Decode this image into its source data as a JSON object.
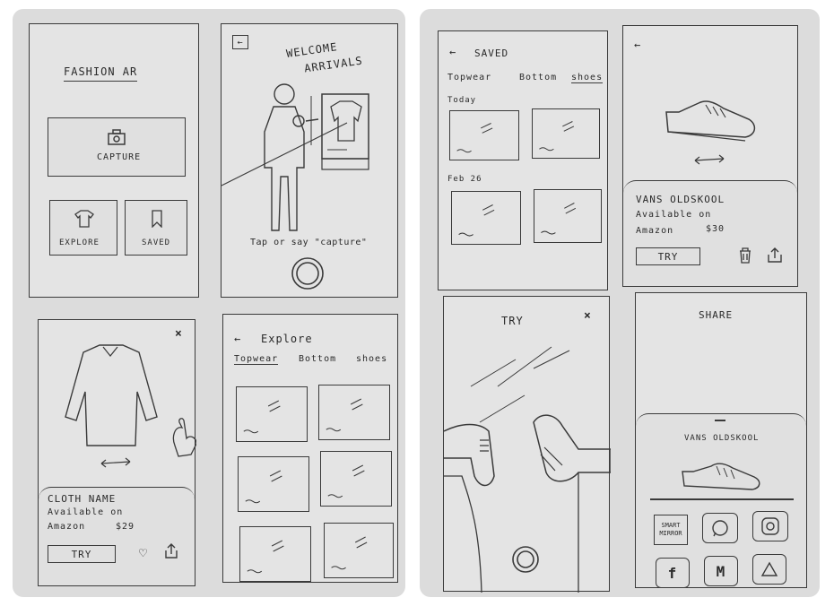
{
  "home": {
    "title": "FASHION AR",
    "capture_label": "CAPTURE",
    "explore_label": "EXPLORE",
    "saved_label": "SAVED"
  },
  "welcome": {
    "title_line1": "WELCOME",
    "title_line2": "ARRIVALS",
    "hint": "Tap or say \"capture\""
  },
  "cloth_detail": {
    "name": "CLOTH NAME",
    "available_on": "Available on",
    "store": "Amazon",
    "price": "$29",
    "try_label": "TRY"
  },
  "explore": {
    "title": "Explore",
    "tabs": [
      "Topwear",
      "Bottom",
      "shoes"
    ]
  },
  "saved": {
    "title": "SAVED",
    "tabs": [
      "Topwear",
      "Bottom",
      "shoes"
    ],
    "groups": [
      "Today",
      "Feb 26"
    ]
  },
  "shoe_detail": {
    "name": "VANS OLDSKOOL",
    "available_on": "Available on",
    "store": "Amazon",
    "price": "$30",
    "try_label": "TRY"
  },
  "try_screen": {
    "title": "TRY"
  },
  "share": {
    "title": "SHARE",
    "product": "VANS OLDSKOOL",
    "apps": [
      "SMART MIRROR"
    ]
  }
}
